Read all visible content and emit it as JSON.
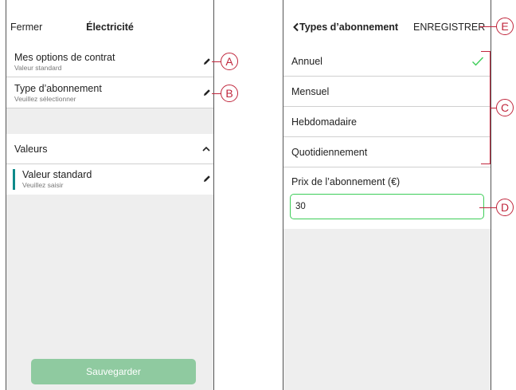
{
  "left": {
    "header": {
      "close": "Fermer",
      "title": "Électricité"
    },
    "rows": [
      {
        "label": "Mes options de contrat",
        "sublabel": "Valeur standard"
      },
      {
        "label": "Type d’abonnement",
        "sublabel": "Veuillez sélectionner"
      }
    ],
    "values_section": {
      "label": "Valeurs"
    },
    "value_item": {
      "label": "Valeur standard",
      "sublabel": "Veuillez saisir"
    },
    "save_button": "Sauvegarder"
  },
  "right": {
    "header": {
      "back": "Types d’abonnement",
      "save": "ENREGISTRER"
    },
    "options": [
      {
        "label": "Annuel",
        "selected": true
      },
      {
        "label": "Mensuel",
        "selected": false
      },
      {
        "label": "Hebdomadaire",
        "selected": false
      },
      {
        "label": "Quotidiennement",
        "selected": false
      }
    ],
    "price": {
      "label": "Prix de l’abonnement (€)",
      "value": "30"
    }
  },
  "callouts": {
    "a": "A",
    "b": "B",
    "c": "C",
    "d": "D",
    "e": "E"
  },
  "colors": {
    "accent_green": "#3dcd58",
    "callout": "#c0263c",
    "save_button": "#8fcaa0",
    "teal_marker": "#0e8a8a"
  },
  "icons": {
    "edit": "pencil-icon",
    "collapse": "chevron-up-icon",
    "back": "chevron-left-icon",
    "check": "check-icon"
  }
}
